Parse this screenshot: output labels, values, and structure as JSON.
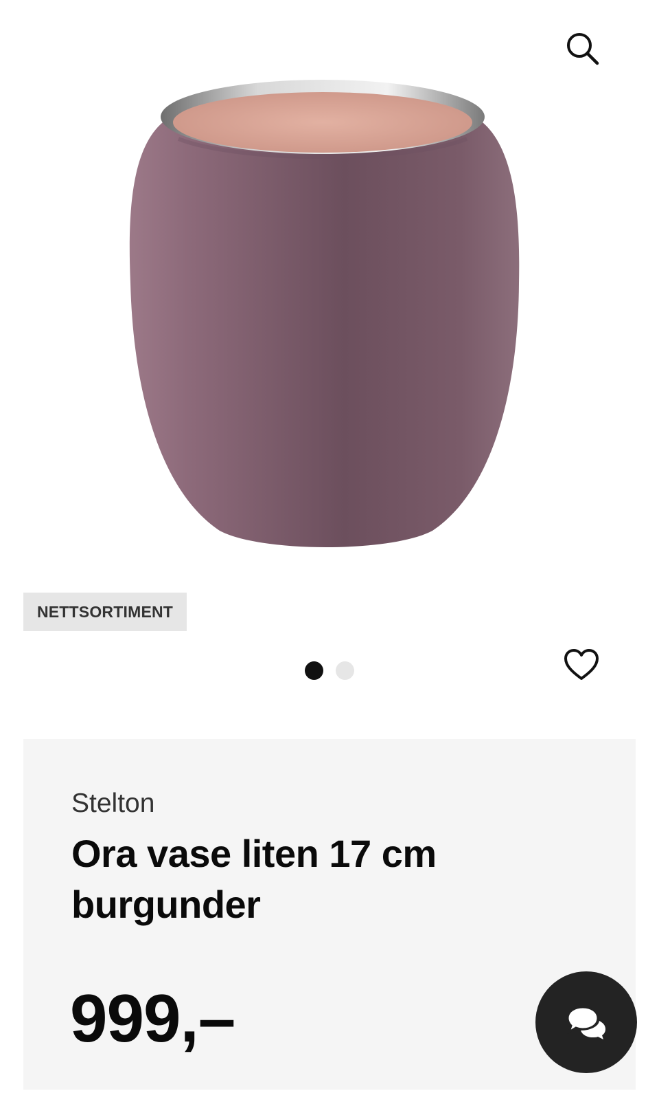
{
  "header": {
    "search_icon": "search-icon"
  },
  "product": {
    "badge": "NETTSORTIMENT",
    "brand": "Stelton",
    "title": "Ora vase liten 17 cm burgunder",
    "price": "999,–",
    "image_count": 2,
    "active_image_index": 0
  },
  "actions": {
    "favorite_icon": "heart-icon",
    "chat_icon": "chat-bubbles-icon"
  },
  "colors": {
    "vase_body": "#7a5866",
    "vase_top": "#d9a595",
    "rim": "#c8c8c8",
    "panel_bg": "#f5f5f5",
    "badge_bg": "#e6e6e6",
    "chat_button": "#232323"
  }
}
